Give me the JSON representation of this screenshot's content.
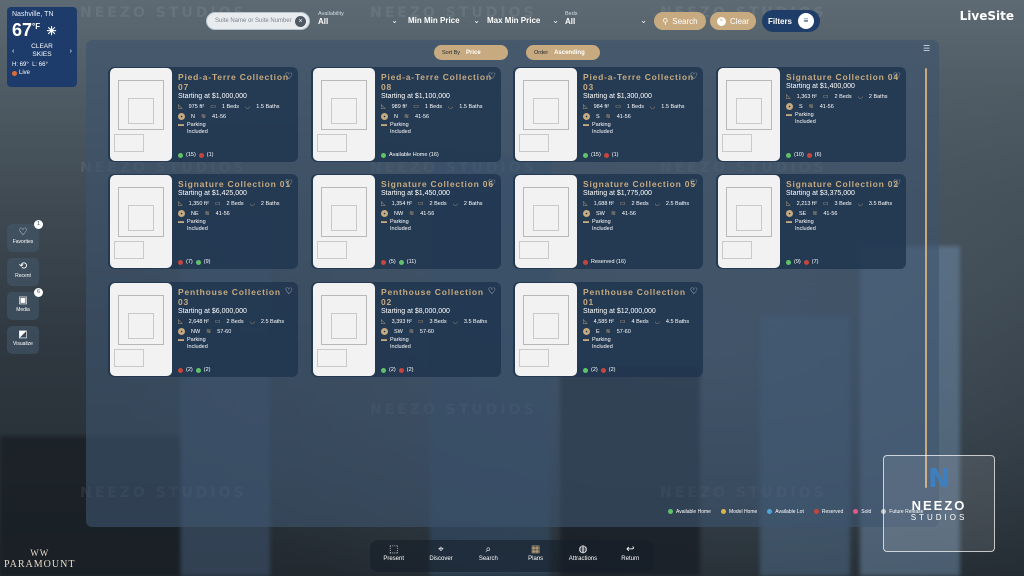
{
  "weather": {
    "city": "Nashville, TN",
    "temp": "67",
    "unit": "°F",
    "condition_line1": "CLEAR",
    "condition_line2": "SKIES",
    "high": "H: 69°",
    "low": "L: 66°",
    "live": "Live"
  },
  "top_bar": {
    "search_placeholder": "Suite Name or Suite Number",
    "availability_label": "Availability",
    "availability_value": "All",
    "min_price_label": "Min Min Price",
    "max_price_label": "Max Min Price",
    "beds_label": "Beds",
    "beds_value": "All",
    "search_btn": "Search",
    "clear_btn": "Clear",
    "filters_btn": "Filters",
    "brand": "LiveSite"
  },
  "sort": {
    "sort_by_label": "Sort By",
    "sort_by_value": "Price",
    "order_label": "Order",
    "order_value": "Ascending"
  },
  "cards": [
    {
      "name": "Pied-a-Terre Collection 07",
      "price": "Starting at $1,000,000",
      "sqft": "975 ft²",
      "beds": "1 Beds",
      "baths": "1.5 Baths",
      "dir": "N",
      "floors": "41-56",
      "parking": "Parking Included",
      "avail_g": "(15)",
      "avail_r": "(1)"
    },
    {
      "name": "Pied-a-Terre Collection 08",
      "price": "Starting at $1,100,000",
      "sqft": "989 ft²",
      "beds": "1 Beds",
      "baths": "1.5 Baths",
      "dir": "N",
      "floors": "41-56",
      "parking": "Parking Included",
      "avail_text": "Available Home (16)"
    },
    {
      "name": "Pied-a-Terre Collection 03",
      "price": "Starting at $1,300,000",
      "sqft": "984 ft²",
      "beds": "1 Beds",
      "baths": "1.5 Baths",
      "dir": "S",
      "floors": "41-56",
      "parking": "Parking Included",
      "avail_g": "(15)",
      "avail_r": "(1)"
    },
    {
      "name": "Signature Collection 04",
      "price": "Starting at $1,400,000",
      "sqft": "1,363 ft²",
      "beds": "2 Beds",
      "baths": "2 Baths",
      "dir": "S",
      "floors": "41-56",
      "parking": "Parking Included",
      "avail_g": "(10)",
      "avail_r": "(6)"
    },
    {
      "name": "Signature Collection 01",
      "price": "Starting at $1,425,000",
      "sqft": "1,350 ft²",
      "beds": "2 Beds",
      "baths": "2 Baths",
      "dir": "NE",
      "floors": "41-56",
      "parking": "Parking Included",
      "avail_r": "(7)",
      "avail_g": "(9)",
      "red_first": true
    },
    {
      "name": "Signature Collection 06",
      "price": "Starting at $1,450,000",
      "sqft": "1,354 ft²",
      "beds": "2 Beds",
      "baths": "2 Baths",
      "dir": "NW",
      "floors": "41-56",
      "parking": "Parking Included",
      "avail_r": "(5)",
      "avail_g": "(11)",
      "red_first": true
    },
    {
      "name": "Signature Collection 05",
      "price": "Starting at $1,775,000",
      "sqft": "1,688 ft²",
      "beds": "2 Beds",
      "baths": "2.5 Baths",
      "dir": "SW",
      "floors": "41-56",
      "parking": "Parking Included",
      "avail_text": "Reserved (16)",
      "red_only": true
    },
    {
      "name": "Signature Collection 02",
      "price": "Starting at $3,375,000",
      "sqft": "2,213 ft²",
      "beds": "3 Beds",
      "baths": "3.5 Baths",
      "dir": "SE",
      "floors": "41-56",
      "parking": "Parking Included",
      "avail_g": "(9)",
      "avail_r": "(7)"
    },
    {
      "name": "Penthouse Collection 03",
      "price": "Starting at $6,000,000",
      "sqft": "2,648 ft²",
      "beds": "2 Beds",
      "baths": "2.5 Baths",
      "dir": "NW",
      "floors": "57-60",
      "parking": "Parking Included",
      "avail_r": "(2)",
      "avail_g": "(2)",
      "red_first": true
    },
    {
      "name": "Penthouse Collection 02",
      "price": "Starting at $8,000,000",
      "sqft": "3,393 ft²",
      "beds": "3 Beds",
      "baths": "3.5 Baths",
      "dir": "SW",
      "floors": "57-60",
      "parking": "Parking Included",
      "avail_g": "(2)",
      "avail_r": "(2)"
    },
    {
      "name": "Penthouse Collection 01",
      "price": "Starting at $12,000,000",
      "sqft": "4,585 ft²",
      "beds": "4 Beds",
      "baths": "4.5 Baths",
      "dir": "E",
      "floors": "57-60",
      "parking": "Parking Included",
      "avail_g": "(2)",
      "avail_r": "(2)"
    }
  ],
  "side_menu": [
    {
      "label": "Favorites",
      "badge": "1"
    },
    {
      "label": "Recent",
      "badge": ""
    },
    {
      "label": "Media",
      "badge": "6"
    },
    {
      "label": "Visualize",
      "badge": ""
    }
  ],
  "legend": [
    "Available Home",
    "Model Home",
    "Available Lot",
    "Reserved",
    "Sold",
    "Future Release"
  ],
  "legend_colors": [
    "#5fc26b",
    "#d8b64a",
    "#4fa7d9",
    "#c6453e",
    "#e05a8a",
    "#bfbfbf"
  ],
  "neezo": {
    "line1": "NEEZO",
    "line2": "STUDIOS"
  },
  "paramount": "PARAMOUNT",
  "watermark": "NEEZO STUDIOS",
  "bottom_nav": [
    "Present",
    "Discover",
    "Search",
    "Plans",
    "Attractions",
    "Return"
  ],
  "bottom_nav_active": "Plans"
}
